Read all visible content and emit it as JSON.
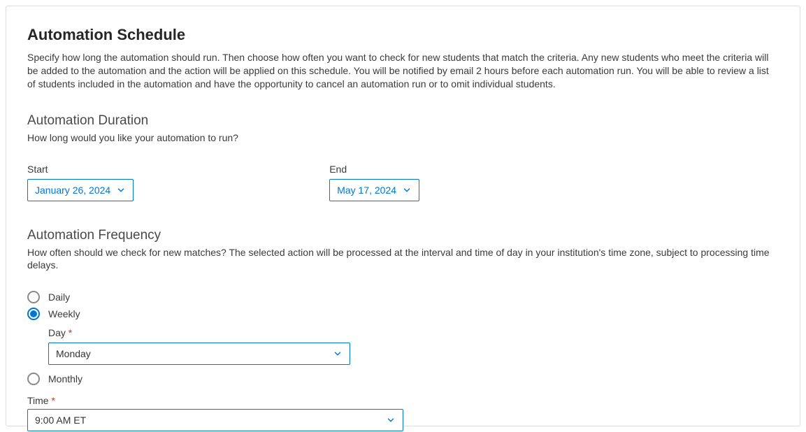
{
  "header": {
    "title": "Automation Schedule",
    "description": "Specify how long the automation should run. Then choose how often you want to check for new students that match the criteria. Any new students who meet the criteria will be added to the automation and the action will be applied on this schedule. You will be notified by email 2 hours before each automation run. You will be able to review a list of students included in the automation and have the opportunity to cancel an automation run or to omit individual students."
  },
  "duration": {
    "title": "Automation Duration",
    "description": "How long would you like your automation to run?",
    "start_label": "Start",
    "end_label": "End",
    "start_value": "January 26, 2024",
    "end_value": "May 17, 2024"
  },
  "frequency": {
    "title": "Automation Frequency",
    "description": "How often should we check for new matches? The selected action will be processed at the interval and time of day in your institution's time zone, subject to processing time delays.",
    "options": {
      "daily": "Daily",
      "weekly": "Weekly",
      "monthly": "Monthly"
    },
    "day_label": "Day",
    "day_value": "Monday",
    "time_label": "Time",
    "time_value": "9:00 AM ET",
    "required_marker": "*"
  }
}
